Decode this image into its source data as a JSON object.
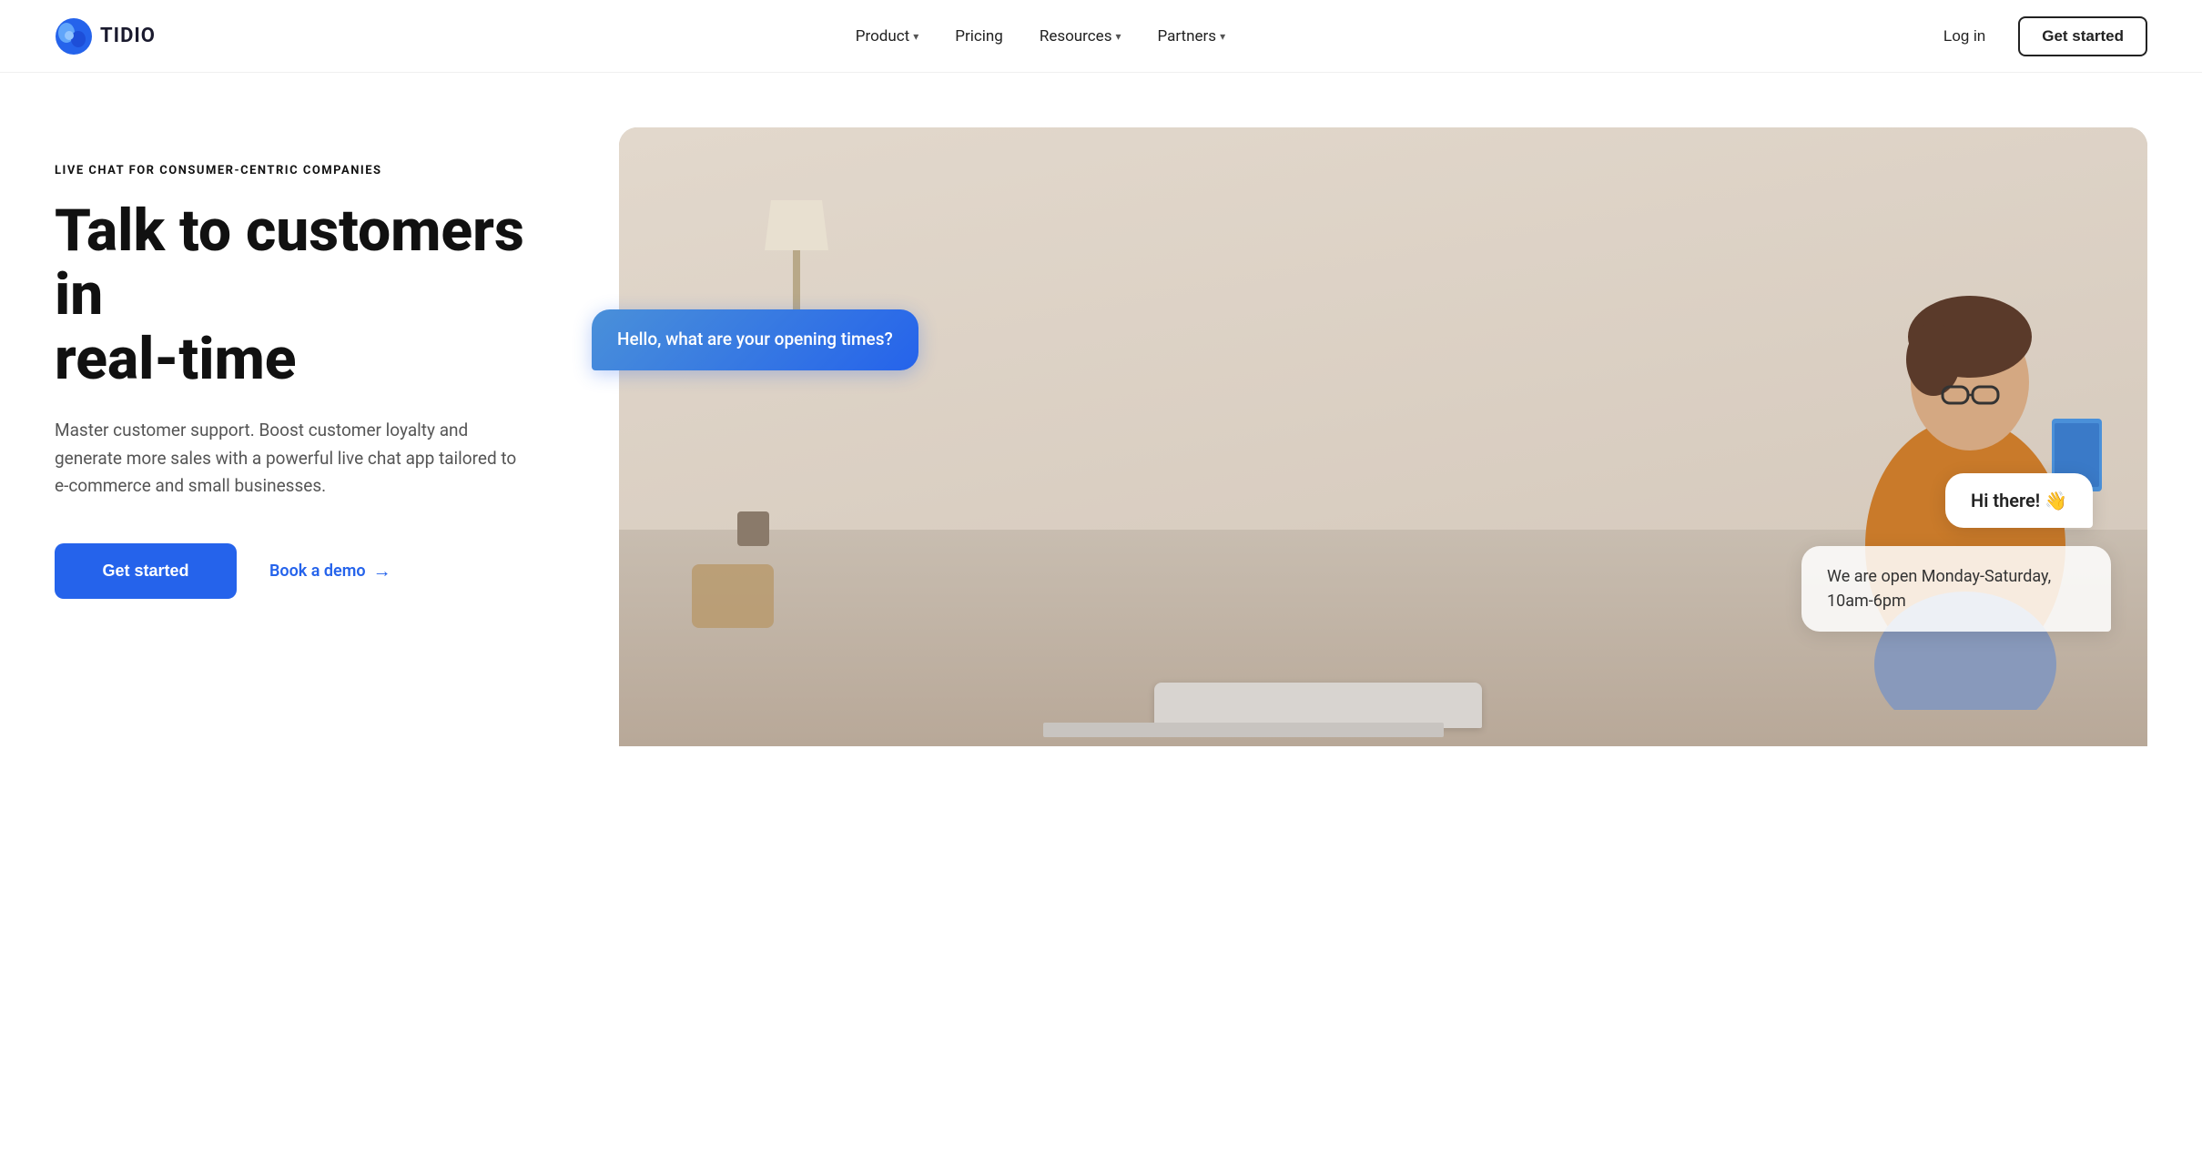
{
  "brand": {
    "name": "TIDIO",
    "logo_text": "TIDIO"
  },
  "nav": {
    "links": [
      {
        "label": "Product",
        "has_dropdown": true,
        "id": "product"
      },
      {
        "label": "Pricing",
        "has_dropdown": false,
        "id": "pricing"
      },
      {
        "label": "Resources",
        "has_dropdown": true,
        "id": "resources"
      },
      {
        "label": "Partners",
        "has_dropdown": true,
        "id": "partners"
      }
    ],
    "login_label": "Log in",
    "get_started_label": "Get started"
  },
  "hero": {
    "tag": "LIVE CHAT FOR CONSUMER-CENTRIC COMPANIES",
    "title_line1": "Talk to customers in",
    "title_line2": "real-time",
    "subtitle": "Master customer support. Boost customer loyalty and generate more sales with a powerful live chat app tailored to e-commerce and small businesses.",
    "cta_primary": "Get started",
    "cta_secondary": "Book a demo",
    "cta_arrow": "→"
  },
  "chat": {
    "bubble_left": "Hello, what are your opening times?",
    "bubble_right_1": "Hi there! 👋",
    "bubble_right_2": "We are open Monday-Saturday, 10am-6pm"
  },
  "colors": {
    "accent_blue": "#2563eb",
    "text_dark": "#111111",
    "text_muted": "#555555",
    "border": "#e5e7eb"
  }
}
